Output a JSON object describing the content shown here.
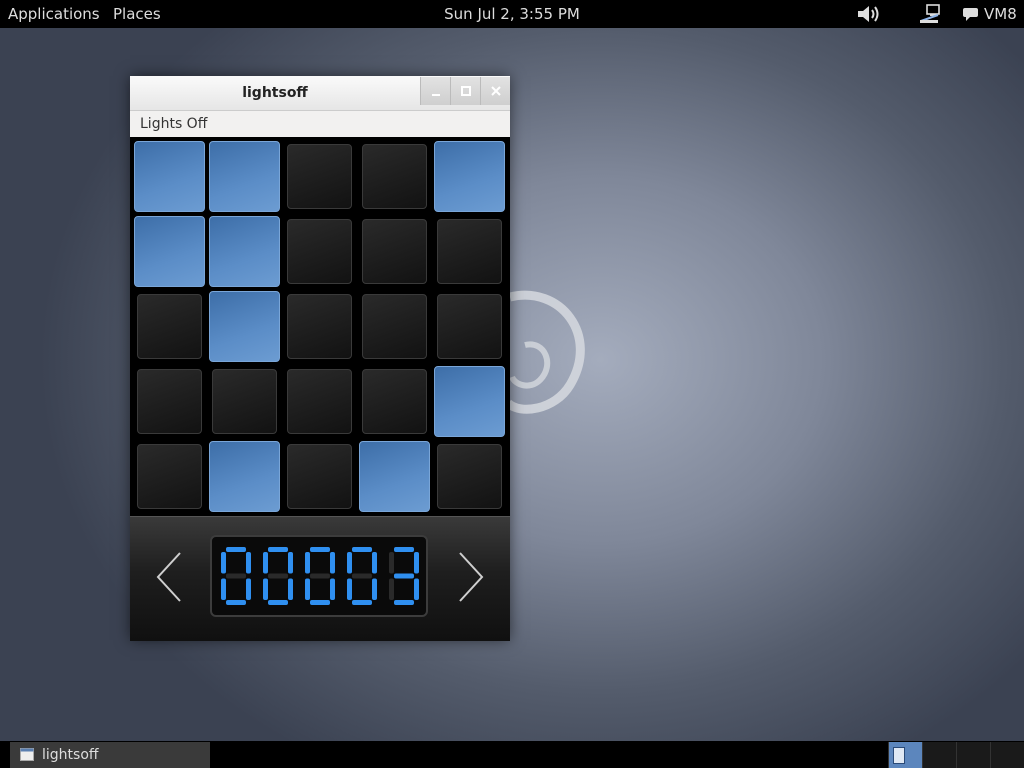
{
  "topbar": {
    "applications": "Applications",
    "places": "Places",
    "clock": "Sun Jul  2,  3:55 PM",
    "user": "VM8",
    "icons": [
      "volume-icon",
      "network-icon",
      "chat-icon"
    ]
  },
  "window": {
    "title": "lightsoff",
    "menu": "Lights Off",
    "controls": [
      "minimize-icon",
      "maximize-icon",
      "close-icon"
    ]
  },
  "board": {
    "rows": [
      [
        1,
        1,
        0,
        0,
        1
      ],
      [
        1,
        1,
        0,
        0,
        0
      ],
      [
        0,
        1,
        0,
        0,
        0
      ],
      [
        0,
        0,
        0,
        0,
        1
      ],
      [
        0,
        1,
        0,
        1,
        0
      ]
    ]
  },
  "level": {
    "digits": "00003",
    "prev_icon": "chevron-left-icon",
    "next_icon": "chevron-right-icon"
  },
  "taskbar": {
    "task_label": "lightsoff",
    "workspaces": 4,
    "active_workspace": 1
  },
  "colors": {
    "light_on": "#5b8dc7",
    "light_off": "#1c1c1c",
    "segment_on": "#2f8ff0",
    "segment_off": "#2a2a2a"
  }
}
